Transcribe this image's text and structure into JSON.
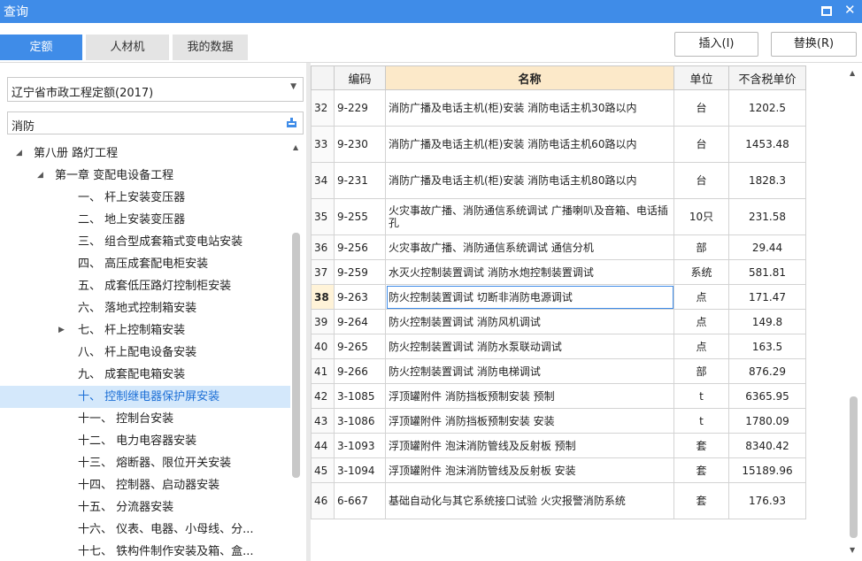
{
  "window": {
    "title": "查询"
  },
  "tabs": [
    {
      "label": "定额",
      "active": true
    },
    {
      "label": "人材机",
      "active": false
    },
    {
      "label": "我的数据",
      "active": false
    }
  ],
  "toolbar": {
    "insert_label": "插入(I)",
    "replace_label": "替换(R)"
  },
  "left": {
    "library_value": "辽宁省市政工程定额(2017)",
    "search_value": "消防",
    "tree": [
      {
        "label": "第八册 路灯工程",
        "level": 0,
        "expander": "expanded"
      },
      {
        "label": "第一章 变配电设备工程",
        "level": 1,
        "expander": "expanded"
      },
      {
        "label": "一、 杆上安装变压器",
        "level": 2,
        "expander": ""
      },
      {
        "label": "二、 地上安装变压器",
        "level": 2,
        "expander": ""
      },
      {
        "label": "三、 组合型成套箱式变电站安装",
        "level": 2,
        "expander": ""
      },
      {
        "label": "四、 高压成套配电柜安装",
        "level": 2,
        "expander": ""
      },
      {
        "label": "五、 成套低压路灯控制柜安装",
        "level": 2,
        "expander": ""
      },
      {
        "label": "六、 落地式控制箱安装",
        "level": 2,
        "expander": ""
      },
      {
        "label": "七、 杆上控制箱安装",
        "level": 2,
        "expander": "collapsed"
      },
      {
        "label": "八、 杆上配电设备安装",
        "level": 2,
        "expander": ""
      },
      {
        "label": "九、 成套配电箱安装",
        "level": 2,
        "expander": ""
      },
      {
        "label": "十、 控制继电器保护屏安装",
        "level": 2,
        "expander": "",
        "selected": true
      },
      {
        "label": "十一、 控制台安装",
        "level": 2,
        "expander": ""
      },
      {
        "label": "十二、 电力电容器安装",
        "level": 2,
        "expander": ""
      },
      {
        "label": "十三、 熔断器、限位开关安装",
        "level": 2,
        "expander": ""
      },
      {
        "label": "十四、 控制器、启动器安装",
        "level": 2,
        "expander": ""
      },
      {
        "label": "十五、 分流器安装",
        "level": 2,
        "expander": ""
      },
      {
        "label": "十六、 仪表、电器、小母线、分...",
        "level": 2,
        "expander": ""
      },
      {
        "label": "十七、 铁构件制作安装及箱、盒...",
        "level": 2,
        "expander": ""
      }
    ]
  },
  "grid": {
    "headers": {
      "code": "编码",
      "name": "名称",
      "unit": "单位",
      "price": "不含税单价"
    },
    "rows": [
      {
        "idx": "32",
        "code": "9-229",
        "name": "消防广播及电话主机(柜)安装 消防电话主机30路以内",
        "unit": "台",
        "price": "1202.5"
      },
      {
        "idx": "33",
        "code": "9-230",
        "name": "消防广播及电话主机(柜)安装 消防电话主机60路以内",
        "unit": "台",
        "price": "1453.48"
      },
      {
        "idx": "34",
        "code": "9-231",
        "name": "消防广播及电话主机(柜)安装 消防电话主机80路以内",
        "unit": "台",
        "price": "1828.3"
      },
      {
        "idx": "35",
        "code": "9-255",
        "name": "火灾事故广播、消防通信系统调试 广播喇叭及音箱、电话插孔",
        "unit": "10只",
        "price": "231.58"
      },
      {
        "idx": "36",
        "code": "9-256",
        "name": "火灾事故广播、消防通信系统调试 通信分机",
        "unit": "部",
        "price": "29.44"
      },
      {
        "idx": "37",
        "code": "9-259",
        "name": "水灭火控制装置调试 消防水炮控制装置调试",
        "unit": "系统",
        "price": "581.81"
      },
      {
        "idx": "38",
        "code": "9-263",
        "name": "防火控制装置调试 切断非消防电源调试",
        "unit": "点",
        "price": "171.47",
        "current": true
      },
      {
        "idx": "39",
        "code": "9-264",
        "name": "防火控制装置调试 消防风机调试",
        "unit": "点",
        "price": "149.8"
      },
      {
        "idx": "40",
        "code": "9-265",
        "name": "防火控制装置调试 消防水泵联动调试",
        "unit": "点",
        "price": "163.5"
      },
      {
        "idx": "41",
        "code": "9-266",
        "name": "防火控制装置调试 消防电梯调试",
        "unit": "部",
        "price": "876.29"
      },
      {
        "idx": "42",
        "code": "3-1085",
        "name": "浮顶罐附件 消防挡板预制安装 预制",
        "unit": "t",
        "price": "6365.95"
      },
      {
        "idx": "43",
        "code": "3-1086",
        "name": "浮顶罐附件 消防挡板预制安装 安装",
        "unit": "t",
        "price": "1780.09"
      },
      {
        "idx": "44",
        "code": "3-1093",
        "name": "浮顶罐附件 泡沫消防管线及反射板 预制",
        "unit": "套",
        "price": "8340.42"
      },
      {
        "idx": "45",
        "code": "3-1094",
        "name": "浮顶罐附件 泡沫消防管线及反射板 安装",
        "unit": "套",
        "price": "15189.96"
      },
      {
        "idx": "46",
        "code": "6-667",
        "name": "基础自动化与其它系统接口试验 火灾报警消防系统",
        "unit": "套",
        "price": "176.93"
      }
    ]
  },
  "colors": {
    "accent": "#3f8ce8",
    "header_name_bg": "#fce9c9",
    "selected_bg": "#d4e8fb"
  }
}
